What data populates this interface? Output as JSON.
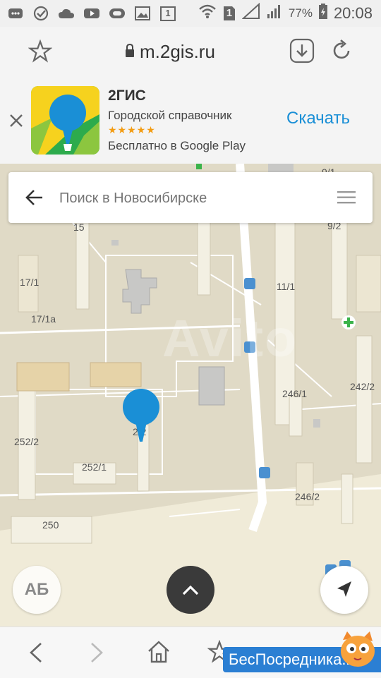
{
  "status_bar": {
    "left_icons": [
      "messages-icon",
      "check-circle-icon",
      "cloud-icon",
      "youtube-icon",
      "ring-icon",
      "image-icon",
      "calendar-icon"
    ],
    "calendar_day": "1",
    "sim_badge": "1",
    "battery_percent": "77%",
    "time": "20:08"
  },
  "browser": {
    "url": "m.2gis.ru"
  },
  "promo": {
    "app_name": "2ГИС",
    "subtitle": "Городской справочник",
    "stars": "★★★★★",
    "store_text": "Бесплатно в Google Play",
    "download_label": "Скачать"
  },
  "search": {
    "placeholder": "Поиск в Новосибирске"
  },
  "map": {
    "labels": [
      "9/1",
      "15",
      "9/2",
      "17/1",
      "11/1",
      "17/1а",
      "242/2",
      "246/1",
      "252/2",
      "252/1",
      "246/2",
      "250",
      "2/2"
    ],
    "watermark": "Avito",
    "layers_button_label": "АБ"
  },
  "colors": {
    "accent": "#1a8fd6",
    "map_bg": "#e0dac6",
    "building": "#f3f0e3",
    "road": "#ffffff",
    "marker": "#1a8fd6",
    "fab_dark": "#3a3a3a"
  },
  "overlay": {
    "brand_text": "БесПосредника",
    "brand_suffix": ".ru"
  }
}
